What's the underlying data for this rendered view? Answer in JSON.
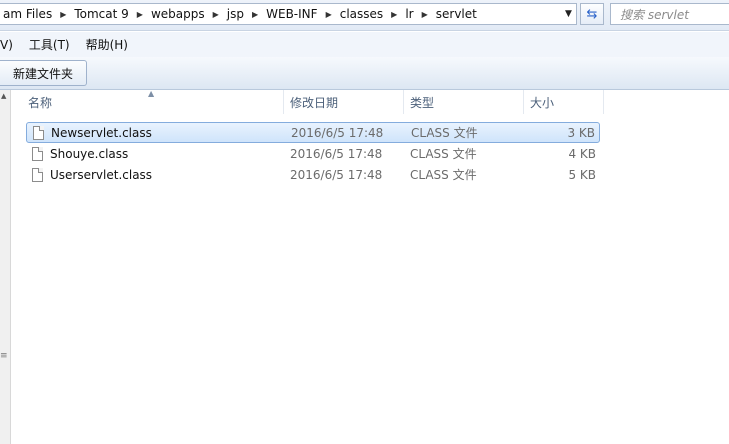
{
  "address_bar": {
    "crumbs": [
      "am Files",
      "Tomcat 9",
      "webapps",
      "jsp",
      "WEB-INF",
      "classes",
      "lr",
      "servlet"
    ],
    "dropdown_icon": "chevron-down-icon",
    "refresh_icon": "refresh-icon"
  },
  "search": {
    "placeholder": "搜索 servlet"
  },
  "menu": {
    "items": [
      "V)",
      "工具(T)",
      "帮助(H)"
    ]
  },
  "command_bar": {
    "new_folder_label": "新建文件夹"
  },
  "columns": {
    "name": "名称",
    "date": "修改日期",
    "type": "类型",
    "size": "大小"
  },
  "files": [
    {
      "name": "Newservlet.class",
      "date": "2016/6/5 17:48",
      "type": "CLASS 文件",
      "size": "3 KB",
      "selected": true
    },
    {
      "name": "Shouye.class",
      "date": "2016/6/5 17:48",
      "type": "CLASS 文件",
      "size": "4 KB",
      "selected": false
    },
    {
      "name": "Userservlet.class",
      "date": "2016/6/5 17:48",
      "type": "CLASS 文件",
      "size": "5 KB",
      "selected": false
    }
  ]
}
